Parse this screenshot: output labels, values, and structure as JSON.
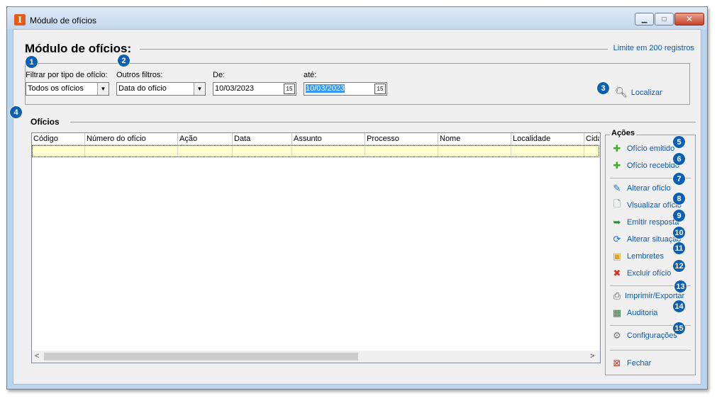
{
  "window": {
    "title": "Módulo de ofícios",
    "app_icon": "I",
    "minimize": "▁",
    "maximize": "□",
    "close": "✕"
  },
  "header": {
    "title": "Módulo de ofícios:",
    "limit_text": "Limite em 200 registros"
  },
  "filters": {
    "type_label": "Filtrar por tipo de ofício:",
    "type_value": "Todos os ofícios",
    "other_label": "Outros filtros:",
    "other_value": "Data do ofício",
    "from_label": "De:",
    "from_value": "10/03/2023",
    "to_label": "até:",
    "to_value": "10/03/2023",
    "calendar_glyph": "15",
    "arrow_glyph": "▼",
    "find_label": "Localizar"
  },
  "grid": {
    "title": "Ofícios",
    "columns": [
      "Código",
      "Número do ofício",
      "Ação",
      "Data",
      "Assunto",
      "Processo",
      "Nome",
      "Localidade",
      "Cida"
    ],
    "scroll_left": "<",
    "scroll_right": ">"
  },
  "actions": {
    "title": "Ações",
    "items": [
      {
        "label": "Ofício emitido",
        "icon": "plus-icon",
        "glyph": "✚",
        "color": "#3fae2a"
      },
      {
        "label": "Ofício recebido",
        "icon": "plus-icon",
        "glyph": "✚",
        "color": "#3fae2a"
      },
      {
        "label": "Alterar ofício",
        "icon": "edit-icon",
        "glyph": "✎",
        "color": "#2c6fb8"
      },
      {
        "label": "Visualizar ofício",
        "icon": "document-icon",
        "glyph": "🗋",
        "color": "#5b7fa6"
      },
      {
        "label": "Emitir resposta",
        "icon": "reply-icon",
        "glyph": "➥",
        "color": "#2d8a3a"
      },
      {
        "label": "Alterar situação",
        "icon": "refresh-icon",
        "glyph": "⟳",
        "color": "#1f6fd1"
      },
      {
        "label": "Lembretes",
        "icon": "note-icon",
        "glyph": "▣",
        "color": "#d9a520"
      },
      {
        "label": "Excluir ofício",
        "icon": "delete-icon",
        "glyph": "✖",
        "color": "#d6321f"
      },
      {
        "label": "Imprimir/Exportar",
        "icon": "printer-icon",
        "glyph": "⎙",
        "color": "#555555"
      },
      {
        "label": "Auditoria",
        "icon": "calendar-icon",
        "glyph": "▦",
        "color": "#2a7a3a"
      },
      {
        "label": "Configurações",
        "icon": "gear-icon",
        "glyph": "⚙",
        "color": "#777777"
      },
      {
        "label": "Fechar",
        "icon": "close-window-icon",
        "glyph": "⊠",
        "color": "#c0392b"
      }
    ]
  },
  "badges": [
    "1",
    "2",
    "3",
    "4",
    "5",
    "6",
    "7",
    "8",
    "9",
    "10",
    "11",
    "12",
    "13",
    "14",
    "15"
  ],
  "colors": {
    "link": "#0d58b4",
    "badge": "#0d5fb1",
    "selected_row": "#ffffd1",
    "selection": "#3399ff"
  }
}
